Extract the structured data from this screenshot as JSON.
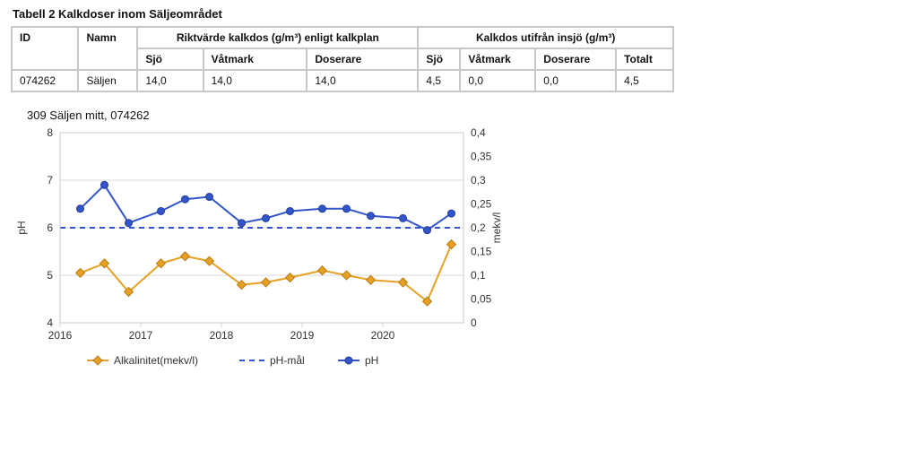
{
  "table": {
    "caption": "Tabell 2 Kalkdoser inom Säljeområdet",
    "headers": {
      "id": "ID",
      "namn": "Namn",
      "group1": "Riktvärde kalkdos (g/m³) enligt kalkplan",
      "group2": "Kalkdos utifrån insjö (g/m³)",
      "sub": [
        "Sjö",
        "Våtmark",
        "Doserare",
        "Sjö",
        "Våtmark",
        "Doserare",
        "Totalt"
      ]
    },
    "rows": [
      {
        "id": "074262",
        "namn": "Säljen",
        "g1_sjo": "14,0",
        "g1_vat": "14,0",
        "g1_dos": "14,0",
        "g2_sjo": "4,5",
        "g2_vat": "0,0",
        "g2_dos": "0,0",
        "g2_tot": "4,5"
      }
    ]
  },
  "chart": {
    "title": "309 Säljen  mitt,  074262",
    "ylabel_left": "pH",
    "ylabel_right": "mekv/l",
    "legend": {
      "alk": "Alkalinitet(mekv/l)",
      "goal": "pH-mål",
      "ph": "pH"
    }
  },
  "chart_data": {
    "type": "line",
    "x_range": [
      2016,
      2021
    ],
    "x_ticks": [
      2016,
      2017,
      2018,
      2019,
      2020
    ],
    "y_left": {
      "label": "pH",
      "range": [
        4,
        8
      ],
      "ticks": [
        4,
        5,
        6,
        7,
        8
      ]
    },
    "y_right": {
      "label": "mekv/l",
      "range": [
        0,
        0.4
      ],
      "ticks": [
        0,
        0.05,
        0.1,
        0.15,
        0.2,
        0.25,
        0.3,
        0.35,
        0.4
      ]
    },
    "ph_goal": 6.0,
    "series": [
      {
        "name": "pH",
        "axis": "left",
        "x": [
          2016.25,
          2016.55,
          2016.85,
          2017.25,
          2017.55,
          2017.85,
          2018.25,
          2018.55,
          2018.85,
          2019.25,
          2019.55,
          2019.85,
          2020.25,
          2020.55,
          2020.85
        ],
        "y": [
          6.4,
          6.9,
          6.1,
          6.35,
          6.6,
          6.65,
          6.1,
          6.2,
          6.35,
          6.4,
          6.4,
          6.25,
          6.2,
          5.95,
          6.3
        ]
      },
      {
        "name": "Alkalinitet(mekv/l)",
        "axis": "right",
        "x": [
          2016.25,
          2016.55,
          2016.85,
          2017.25,
          2017.55,
          2017.85,
          2018.25,
          2018.55,
          2018.85,
          2019.25,
          2019.55,
          2019.85,
          2020.25,
          2020.55,
          2020.85
        ],
        "y": [
          0.105,
          0.125,
          0.065,
          0.125,
          0.14,
          0.13,
          0.08,
          0.085,
          0.095,
          0.11,
          0.1,
          0.09,
          0.085,
          0.045,
          0.165
        ]
      }
    ]
  }
}
